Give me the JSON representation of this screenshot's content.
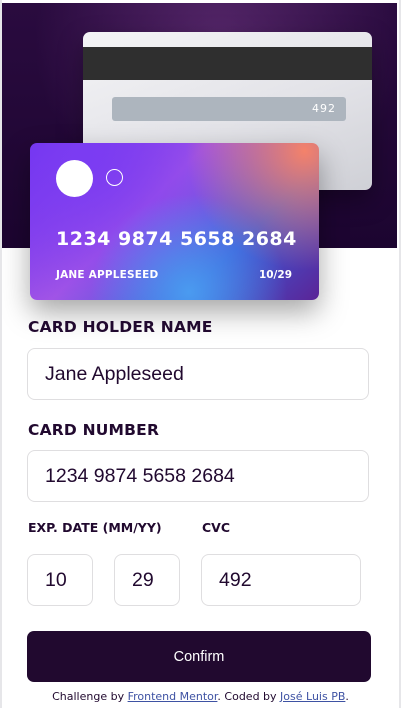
{
  "card_back": {
    "cvc": "492"
  },
  "card_front": {
    "number": "1234 9874 5658 2684",
    "holder": "JANE APPLESEED",
    "expiry": "10/29"
  },
  "form": {
    "holder_label": "CARD HOLDER NAME",
    "holder_value": "Jane Appleseed",
    "number_label": "CARD NUMBER",
    "number_value": "1234 9874 5658 2684",
    "expiry_label": "EXP. DATE (MM/YY)",
    "month_value": "10",
    "year_value": "29",
    "cvc_label": "CVC",
    "cvc_value": "492",
    "confirm_label": "Confirm"
  },
  "footer": {
    "prefix": "Challenge by ",
    "fm_link": "Frontend Mentor",
    "middle": ". Coded by ",
    "author_link": "José Luis PB",
    "suffix": "."
  },
  "colors": {
    "dark": "#21092f",
    "link": "#3e52a3",
    "input_border": "#dfdee0"
  }
}
